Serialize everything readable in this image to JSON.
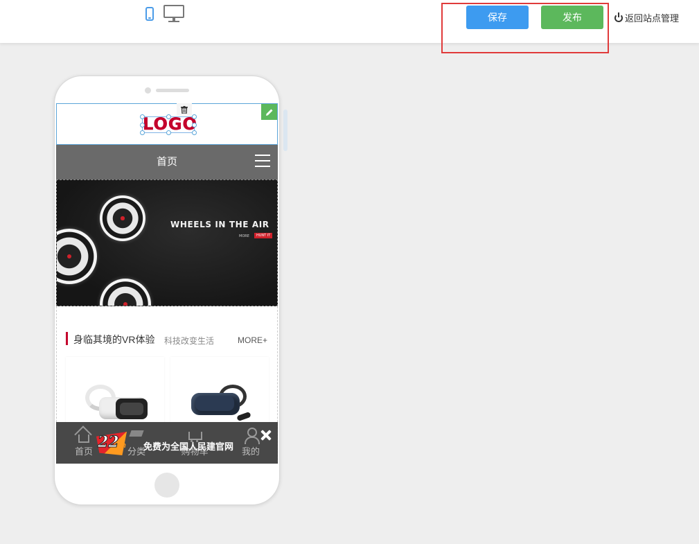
{
  "toolbar": {
    "devices": [
      "mobile-icon",
      "desktop-icon"
    ],
    "save_label": "保存",
    "publish_label": "发布",
    "back_label": "返回站点管理",
    "colors": {
      "save": "#3d9bf0",
      "publish": "#5cb85c",
      "highlight": "#e03a3a"
    }
  },
  "preview": {
    "logo_text": "LOGO",
    "nav_title": "首页",
    "banner": {
      "title": "WHEELS IN THE AIR",
      "more": "MORE",
      "cta": "HUNT IT"
    },
    "section": {
      "title": "身临其境的VR体验",
      "subtitle": "科技改变生活",
      "more": "MORE+"
    },
    "bottom_nav": [
      {
        "label": "首页",
        "icon": "home-icon"
      },
      {
        "label": "分类",
        "icon": "category-icon"
      },
      {
        "label": "购物车",
        "icon": "cart-icon"
      },
      {
        "label": "我的",
        "icon": "user-icon"
      }
    ],
    "ad": {
      "badge_num": "22",
      "badge_suffix": "cn",
      "text": "免费为全国人民建官网"
    }
  }
}
